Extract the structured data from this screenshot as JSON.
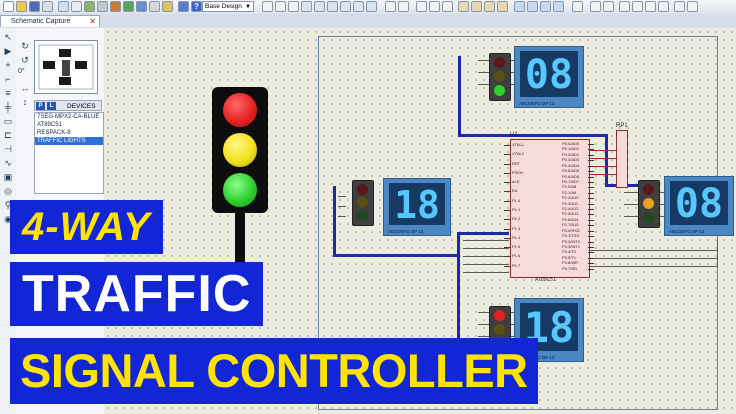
{
  "toolbar": {
    "design_select_value": "Base Design",
    "icons": [
      "new-file-icon",
      "open-folder-icon",
      "save-icon",
      "print-icon",
      "zoom-icon",
      "grid-icon",
      "origin-icon",
      "pointer-icon",
      "help-icon",
      "undo-icon",
      "redo-icon",
      "cut-icon",
      "copy-icon",
      "paste-icon",
      "block-icon",
      "rotate-icon",
      "search-icon",
      "tools-icon"
    ]
  },
  "tabs": [
    {
      "label": "Schematic Capture"
    }
  ],
  "panel": {
    "rotation_value": "0°",
    "devices_header": "DEVICES",
    "devices_p_badge": "P",
    "devices_l_badge": "L",
    "devices": [
      {
        "name": "7SEG-MPX2-CA-BLUE",
        "selected": false
      },
      {
        "name": "AT89C51",
        "selected": false
      },
      {
        "name": "RESPACK-8",
        "selected": false
      },
      {
        "name": "TRAFFIC LIGHTS",
        "selected": true
      }
    ]
  },
  "schematic": {
    "mcu_label": "U1",
    "mcu_part": "AT89C51",
    "respack_label": "RP1",
    "seg_pin_labels": "ABCDEFG DP    12",
    "displays": [
      {
        "id": "north",
        "value": "08"
      },
      {
        "id": "west",
        "value": "18"
      },
      {
        "id": "east",
        "value": "08"
      },
      {
        "id": "south",
        "value": "18"
      }
    ],
    "mcu_pins_left": [
      "XTAL1",
      "XTAL2",
      "RST",
      "PSEN",
      "ALE",
      "EA",
      "P1.0",
      "P1.1",
      "P1.2",
      "P1.3",
      "P1.4",
      "P1.5",
      "P1.6",
      "P1.7"
    ],
    "mcu_pins_right": [
      "P0.0/AD0",
      "P0.1/AD1",
      "P0.2/AD2",
      "P0.3/AD3",
      "P0.4/AD4",
      "P0.5/AD5",
      "P0.6/AD6",
      "P0.7/AD7",
      "P2.0/A8",
      "P2.1/A9",
      "P2.2/A10",
      "P2.3/A11",
      "P2.4/A12",
      "P2.5/A13",
      "P2.6/A14",
      "P2.7/A15",
      "P3.0/RXD",
      "P3.1/TXD",
      "P3.2/INT0",
      "P3.3/INT1",
      "P3.4/T0",
      "P3.5/T1",
      "P3.6/WR",
      "P3.7/RD"
    ]
  },
  "overlay": {
    "line1": "4-WAY",
    "line2": "TRAFFIC",
    "line3": "SIGNAL CONTROLLER"
  },
  "colors": {
    "banner_bg": "#1226d6",
    "banner_yellow": "#ffe400",
    "lamp_red": "#e52222",
    "lamp_yellow": "#f2e21b",
    "lamp_green": "#2fcf2f",
    "display_bg": "#4b87c2",
    "segment_text": "#56c8ff"
  }
}
